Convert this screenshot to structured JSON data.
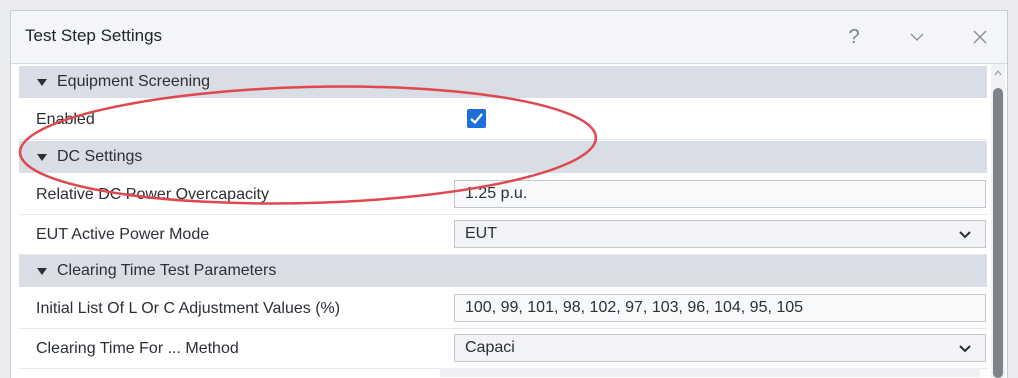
{
  "window": {
    "title": "Test Step Settings",
    "help_label": "?",
    "collapse_icon": "chevron-down-icon",
    "close_icon": "close-icon"
  },
  "sections": [
    {
      "label": "Equipment Screening",
      "properties": [
        {
          "label": "Enabled",
          "type": "checkbox",
          "checked": true
        }
      ]
    },
    {
      "label": "DC Settings",
      "properties": [
        {
          "label": "Relative DC Power Overcapacity",
          "type": "text",
          "value": "1.25 p.u."
        },
        {
          "label": "EUT Active Power Mode",
          "type": "select",
          "value": "EUT"
        }
      ]
    },
    {
      "label": "Clearing Time Test Parameters",
      "properties": [
        {
          "label": "Initial List Of L Or C Adjustment Values (%)",
          "type": "text",
          "value": "100, 99, 101, 98, 102, 97, 103, 96, 104, 95, 105"
        },
        {
          "label": "Clearing Time For ... Method",
          "type": "select",
          "value": "Capaci"
        }
      ]
    }
  ],
  "annotation": {
    "shape": "ellipse",
    "color": "#e0474f"
  },
  "colors": {
    "section_bg": "#d9dde6",
    "checkbox": "#1e6fd9",
    "title_bg": "#f4f5f8"
  }
}
